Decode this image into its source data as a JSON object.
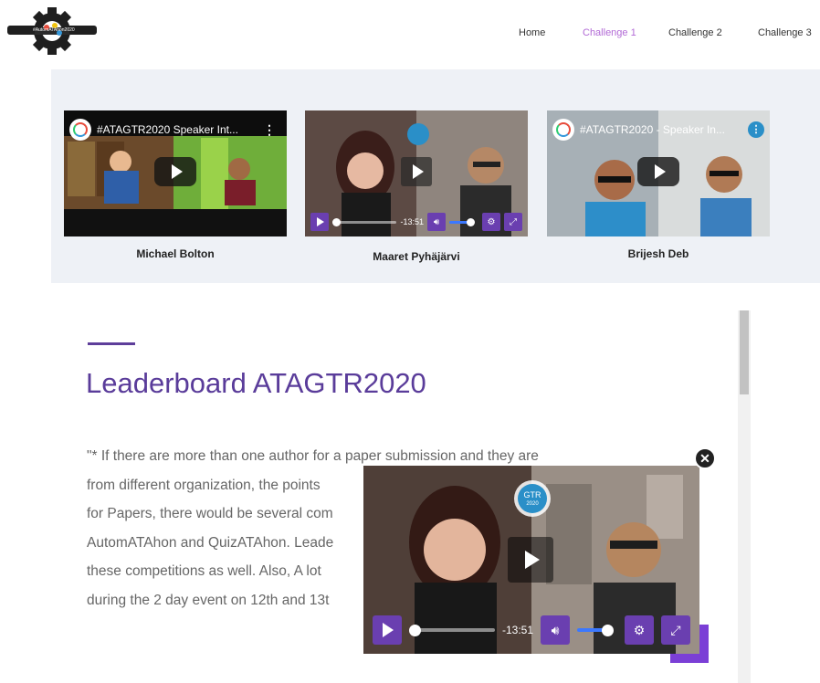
{
  "header": {
    "logo_text": "#AutomATAhon2020",
    "nav": [
      {
        "label": "Home",
        "active": false
      },
      {
        "label": "Challenge 1",
        "active": true
      },
      {
        "label": "Challenge 2",
        "active": false
      },
      {
        "label": "Challenge 3",
        "active": false
      }
    ]
  },
  "videos": [
    {
      "title": "#ATAGTR2020 Speaker Int...",
      "caption": "Michael Bolton",
      "has_title_bar": true
    },
    {
      "title": "",
      "caption": "Maaret Pyhäjärvi",
      "has_title_bar": false,
      "time": "-13:51"
    },
    {
      "title": "#ATAGTR2020 - Speaker In...",
      "caption": "Brijesh Deb",
      "has_title_bar": true
    }
  ],
  "leaderboard": {
    "heading": "Leaderboard ATAGTR2020",
    "lines": [
      "\"* If there are more than one author for a paper submission and they are",
      "from different organization, the points",
      "for Papers, there would be several com",
      "AutomATAhon and QuizATAhon. Leade",
      "these competitions as well. Also, A lot",
      "during the 2 day event on 12th and 13t"
    ]
  },
  "floating_player": {
    "time": "-13:51",
    "badge_text": "GTR",
    "badge_year": "2020"
  },
  "colors": {
    "accent": "#5a3c9a",
    "nav_active": "#b26ad6",
    "control_purple": "#6a3fb0",
    "volume_blue": "#3b78ff"
  },
  "icons": {
    "close": "close-icon",
    "play": "play-icon",
    "volume": "volume-icon",
    "settings": "gear-icon",
    "fullscreen": "fullscreen-icon"
  }
}
